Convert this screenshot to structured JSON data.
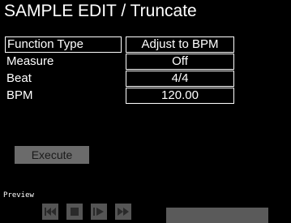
{
  "header": {
    "title": "SAMPLE EDIT / Truncate"
  },
  "params": [
    {
      "label": "Function Type",
      "value": "Adjust to BPM",
      "selected": true
    },
    {
      "label": "Measure",
      "value": "Off",
      "selected": false
    },
    {
      "label": "Beat",
      "value": "4/4",
      "selected": false
    },
    {
      "label": "BPM",
      "value": "120.00",
      "selected": false
    }
  ],
  "execute": {
    "label": "Execute"
  },
  "preview": {
    "label": "Preview",
    "buttons": [
      "skip-back-icon",
      "stop-icon",
      "play-icon",
      "fast-forward-icon"
    ],
    "progress": 0
  }
}
